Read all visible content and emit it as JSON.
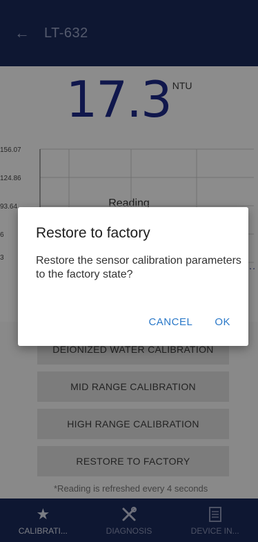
{
  "app": {
    "title": "LT-632",
    "back_icon": "arrow-left-icon"
  },
  "reading": {
    "value": "17.3",
    "unit": "NTU"
  },
  "chart_data": {
    "type": "line",
    "title": "Reading",
    "y_ticks": [
      "156.07",
      "124.86",
      "93.64"
    ],
    "partial_tick_labels": [
      "6",
      "3"
    ],
    "visible_edge_text": "y",
    "grid": true
  },
  "calibration_buttons": {
    "deionized": "DEIONIZED WATER CALIBRATION",
    "mid": "MID RANGE CALIBRATION",
    "high": "HIGH RANGE CALIBRATION",
    "restore": "RESTORE TO FACTORY"
  },
  "note": "*Reading is refreshed every 4 seconds",
  "dialog": {
    "title": "Restore to factory",
    "message": "Restore the sensor calibration parameters to the factory state?",
    "cancel": "CANCEL",
    "ok": "OK"
  },
  "nav": {
    "items": [
      {
        "label": "CALIBRATI...",
        "icon": "star-icon",
        "active": true
      },
      {
        "label": "DIAGNOSIS",
        "icon": "wrench-screwdriver-icon",
        "active": false
      },
      {
        "label": "DEVICE IN...",
        "icon": "document-icon",
        "active": false
      }
    ]
  },
  "colors": {
    "header": "#1b2a5b",
    "reading": "#1e2a8a",
    "dialog_action": "#2a78c8"
  }
}
